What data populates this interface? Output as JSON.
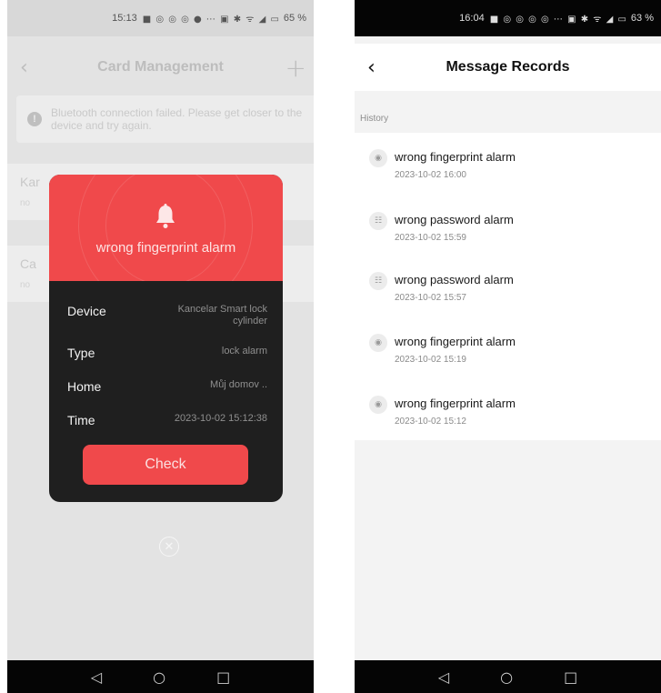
{
  "left": {
    "status": {
      "time": "15:13",
      "icons": "■ ◎ ◎ ◎ ● ⋯ ▣ ✱ ᯤ ◢ ▭",
      "battery": "65 %"
    },
    "nav": {
      "title": "Card Management"
    },
    "banner": {
      "text": "Bluetooth connection failed. Please get closer to the device and try again."
    },
    "background_rows": [
      {
        "label": "Kar",
        "sub": "no"
      },
      {
        "label": "Ca",
        "sub": "no"
      }
    ],
    "popup": {
      "title": "wrong fingerprint alarm",
      "rows": [
        {
          "key": "Device",
          "value": "Kancelar Smart lock cylinder"
        },
        {
          "key": "Type",
          "value": "lock alarm"
        },
        {
          "key": "Home",
          "value": "Můj domov .."
        },
        {
          "key": "Time",
          "value": "2023-10-02 15:12:38"
        }
      ],
      "button": "Check",
      "accent": "#f0494b"
    }
  },
  "right": {
    "status": {
      "time": "16:04",
      "icons": "■ ◎ ◎ ◎ ◎ ⋯ ▣ ✱ ᯤ ◢ ▭",
      "battery": "63 %"
    },
    "nav": {
      "title": "Message Records"
    },
    "section": "History",
    "records": [
      {
        "title": "wrong fingerprint alarm",
        "time": "2023-10-02 16:00",
        "icon": "fingerprint-icon"
      },
      {
        "title": "wrong password alarm",
        "time": "2023-10-02 15:59",
        "icon": "keypad-icon"
      },
      {
        "title": "wrong password alarm",
        "time": "2023-10-02 15:57",
        "icon": "keypad-icon"
      },
      {
        "title": "wrong fingerprint alarm",
        "time": "2023-10-02 15:19",
        "icon": "fingerprint-icon"
      },
      {
        "title": "wrong fingerprint alarm",
        "time": "2023-10-02 15:12",
        "icon": "fingerprint-icon"
      }
    ]
  }
}
